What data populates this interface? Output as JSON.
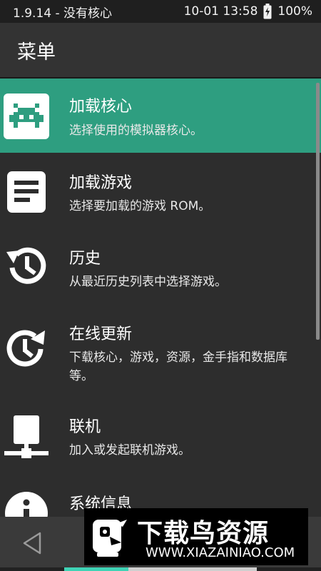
{
  "status_bar": {
    "left_text": "1.9.14 - 没有核心",
    "datetime": "10-01 13:58",
    "battery": "100%"
  },
  "header": {
    "title": "菜单"
  },
  "menu": {
    "items": [
      {
        "title": "加载核心",
        "subtitle": "选择使用的模拟器核心。",
        "icon": "retroarch-invader-icon",
        "selected": true
      },
      {
        "title": "加载游戏",
        "subtitle": "选择要加载的游戏 ROM。",
        "icon": "document-icon",
        "selected": false
      },
      {
        "title": "历史",
        "subtitle": "从最近历史列表中选择游戏。",
        "icon": "history-icon",
        "selected": false
      },
      {
        "title": "在线更新",
        "subtitle": "下载核心，游戏，资源，金手指和数据库等。",
        "icon": "update-icon",
        "selected": false
      },
      {
        "title": "联机",
        "subtitle": "加入或发起联机游戏。",
        "icon": "network-icon",
        "selected": false
      },
      {
        "title": "系统信息",
        "subtitle": "",
        "icon": "info-icon",
        "selected": false
      }
    ]
  },
  "nav": {
    "back_icon": "back-triangle-icon"
  },
  "watermark": {
    "title": "下载鸟资源",
    "url": "WWW.XIAZAINIAO.COM"
  },
  "colors": {
    "selected_bg": "#2e9e80",
    "background": "#2d2d2d",
    "header_bg": "#333333",
    "statusbar_bg": "#1f1f1f"
  }
}
